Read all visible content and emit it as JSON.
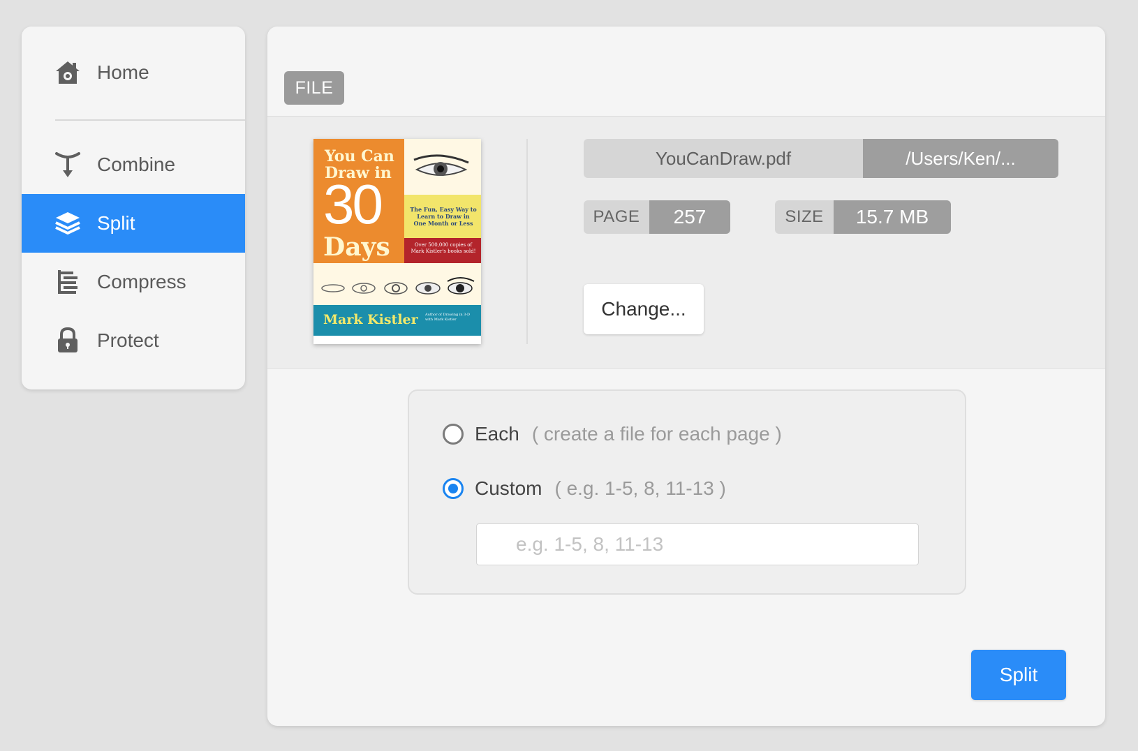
{
  "sidebar": {
    "items": [
      {
        "label": "Home",
        "icon": "home-icon"
      },
      {
        "label": "Combine",
        "icon": "combine-icon"
      },
      {
        "label": "Split",
        "icon": "layers-icon",
        "active": true
      },
      {
        "label": "Compress",
        "icon": "compress-icon"
      },
      {
        "label": "Protect",
        "icon": "lock-icon"
      }
    ]
  },
  "file": {
    "tag": "FILE",
    "name": "YouCanDraw.pdf",
    "path": "/Users/Ken/...",
    "page_label": "PAGE",
    "page_value": "257",
    "size_label": "SIZE",
    "size_value": "15.7 MB",
    "change_label": "Change...",
    "cover": {
      "title_line1": "You Can",
      "title_line2": "Draw in",
      "title_number": "30",
      "title_line3": "Days",
      "subtitle": "The Fun, Easy Way to Learn to Draw in One Month or Less",
      "sales_note": "Over 500,000 copies of Mark Kistler's books sold!",
      "author": "Mark Kistler",
      "author_note": "Author of Drawing in 3-D with Mark Kistler"
    }
  },
  "split_options": {
    "each_label": "Each",
    "each_hint": "( create a file for each page )",
    "custom_label": "Custom",
    "custom_hint": "( e.g. 1-5, 8, 11-13 )",
    "selected": "custom",
    "range_placeholder": "e.g. 1-5, 8, 11-13",
    "range_value": ""
  },
  "actions": {
    "split_label": "Split"
  },
  "colors": {
    "accent": "#2a8cf8",
    "background": "#e2e2e2",
    "panel": "#f5f5f5"
  }
}
